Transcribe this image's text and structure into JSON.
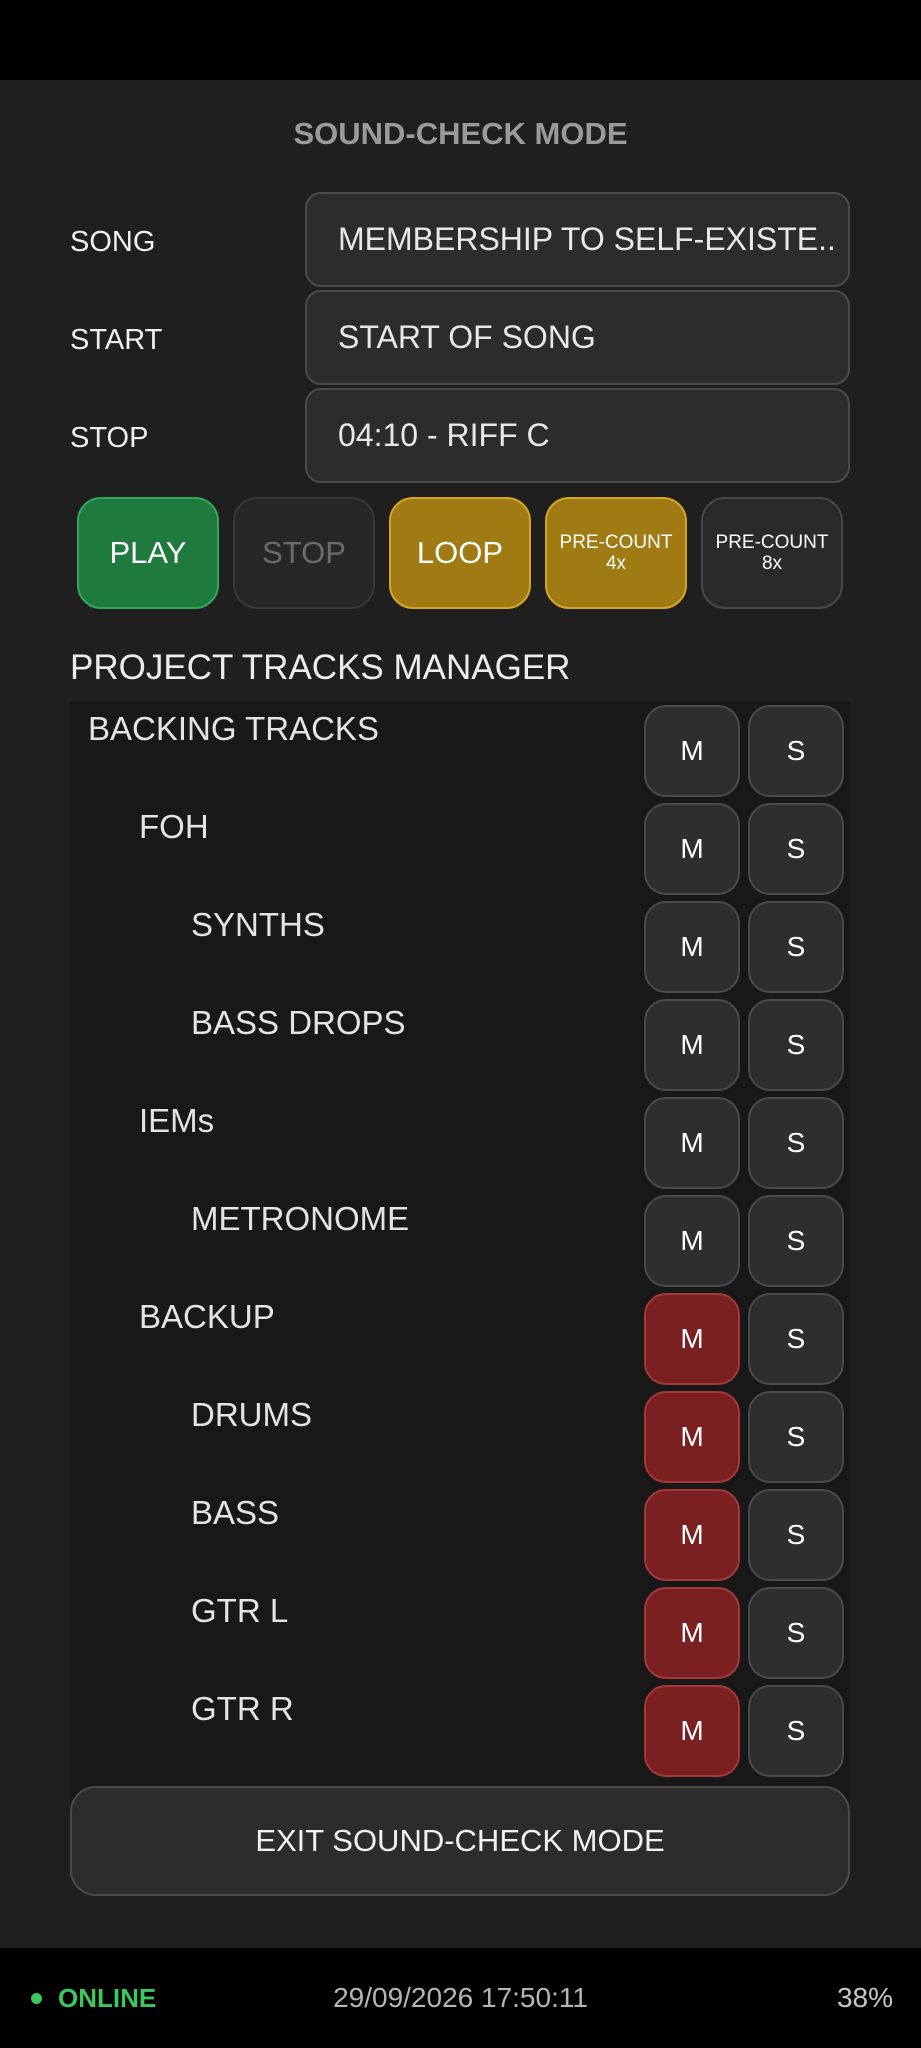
{
  "header": {
    "title": "SOUND-CHECK MODE"
  },
  "fields": {
    "song": {
      "label": "SONG",
      "value": "MEMBERSHIP TO SELF-EXISTE.."
    },
    "start": {
      "label": "START",
      "value": "START OF SONG"
    },
    "stop": {
      "label": "STOP",
      "value": "04:10 - RIFF C"
    }
  },
  "transport": {
    "play": "PLAY",
    "stop": "STOP",
    "loop": "LOOP",
    "precount_4": {
      "line1": "PRE-COUNT",
      "line2": "4x"
    },
    "precount_8": {
      "line1": "PRE-COUNT",
      "line2": "8x"
    }
  },
  "tracks_manager": {
    "title": "PROJECT TRACKS MANAGER",
    "mute_label": "M",
    "solo_label": "S",
    "tracks": [
      {
        "name": "BACKING TRACKS",
        "level": 0,
        "muted": false,
        "solo": false
      },
      {
        "name": "FOH",
        "level": 1,
        "muted": false,
        "solo": false
      },
      {
        "name": "SYNTHS",
        "level": 2,
        "muted": false,
        "solo": false
      },
      {
        "name": "BASS DROPS",
        "level": 2,
        "muted": false,
        "solo": false
      },
      {
        "name": "IEMs",
        "level": 1,
        "muted": false,
        "solo": false
      },
      {
        "name": "METRONOME",
        "level": 2,
        "muted": false,
        "solo": false
      },
      {
        "name": "BACKUP",
        "level": 1,
        "muted": true,
        "solo": false
      },
      {
        "name": "DRUMS",
        "level": 2,
        "muted": true,
        "solo": false
      },
      {
        "name": "BASS",
        "level": 2,
        "muted": true,
        "solo": false
      },
      {
        "name": "GTR L",
        "level": 2,
        "muted": true,
        "solo": false
      },
      {
        "name": "GTR R",
        "level": 2,
        "muted": true,
        "solo": false
      }
    ]
  },
  "exit_button": "EXIT SOUND-CHECK MODE",
  "status_bar": {
    "online": "ONLINE",
    "datetime": "29/09/2026 17:50:11",
    "battery": "38%"
  },
  "colors": {
    "play": "#1f7a3d",
    "loop_active": "#a07a12",
    "mute_active": "#7a2020",
    "online": "#3cc85c"
  }
}
